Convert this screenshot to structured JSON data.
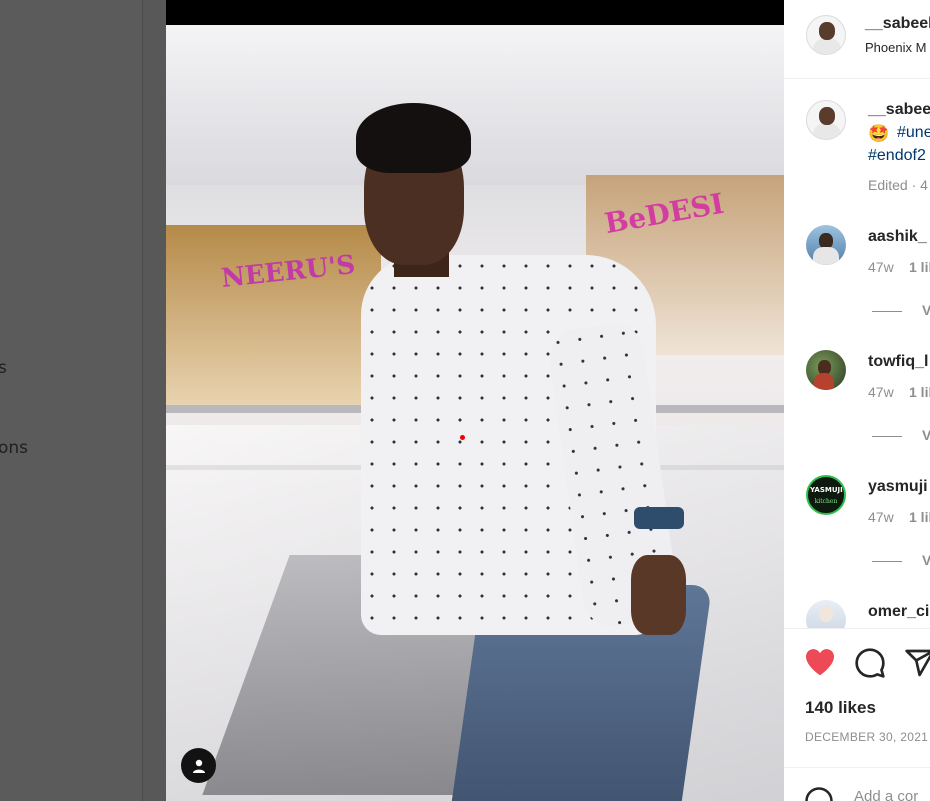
{
  "background_nav": {
    "items": [
      {
        "label": "s"
      },
      {
        "label": "ons"
      }
    ]
  },
  "post": {
    "author": {
      "username": "__sabeel",
      "location": "Phoenix M"
    },
    "caption": {
      "username": "__sabeel",
      "emoji": "🤩",
      "hashtag_1": "#une",
      "hashtag_2": "#endof2",
      "edited": "Edited · 4"
    },
    "comments": [
      {
        "username": "aashik_",
        "time": "47w",
        "likes": "1 lik",
        "view_replies": "V"
      },
      {
        "username": "towfiq_l",
        "time": "47w",
        "likes": "1 lil",
        "view_replies": "V"
      },
      {
        "username": "yasmuji",
        "time": "47w",
        "likes": "1 lil",
        "view_replies": "V",
        "avatar_text": "YASMUJI",
        "avatar_sub": "kitchen"
      },
      {
        "username": "omer_ci"
      }
    ],
    "likes_text": "140 likes",
    "date_text": "DECEMBER 30, 2021",
    "add_comment_placeholder": "Add a cor"
  },
  "photo": {
    "sign_left": "NEERU'S",
    "sign_right": "BeDESI"
  },
  "colors": {
    "heart": "#ed4956",
    "link": "#00376b",
    "muted": "#8e8e8e",
    "overlay": "#585858"
  },
  "icons": {
    "like": "heart-filled-icon",
    "comment": "comment-bubble-icon",
    "share": "paper-plane-icon",
    "tag": "user-tag-icon",
    "emoji": "smiley-icon"
  }
}
